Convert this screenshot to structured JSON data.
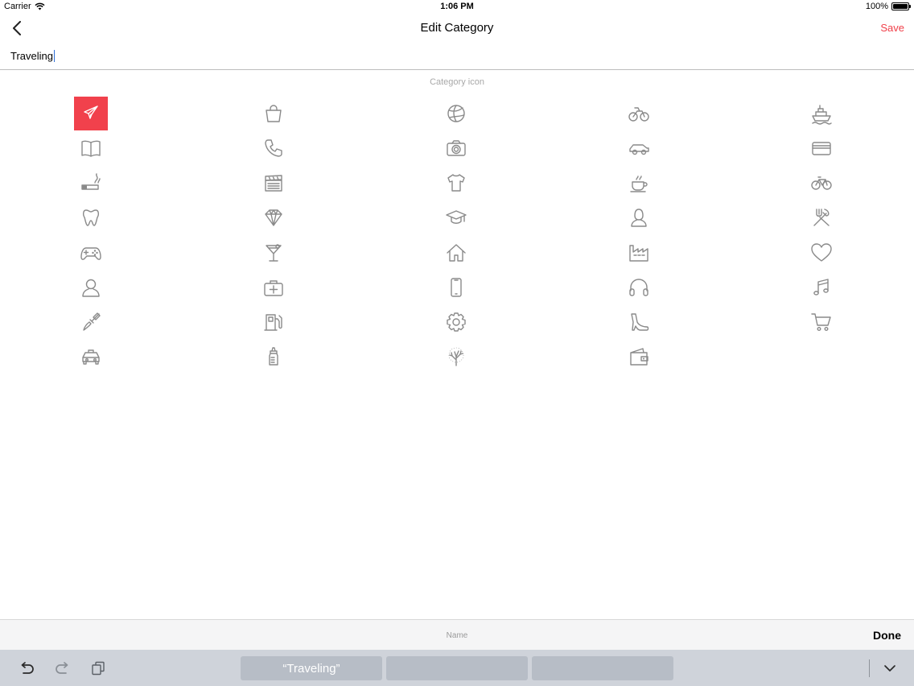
{
  "status_bar": {
    "carrier": "Carrier",
    "time": "1:06 PM",
    "battery": "100%",
    "battery_level": 1.0
  },
  "nav": {
    "title": "Edit Category",
    "save_label": "Save"
  },
  "name_field": {
    "value": "Traveling"
  },
  "section": {
    "label": "Category icon"
  },
  "icons": [
    "airplane-icon",
    "shopping-bag-icon",
    "volleyball-icon",
    "motorcycle-icon",
    "ship-icon",
    "book-icon",
    "phone-icon",
    "camera-icon",
    "car-icon",
    "credit-card-icon",
    "cigarette-icon",
    "clapperboard-icon",
    "tshirt-icon",
    "coffee-cup-icon",
    "bicycle-icon",
    "tooth-icon",
    "diamond-icon",
    "graduation-cap-icon",
    "person-female-icon",
    "fork-knife-icon",
    "gamepad-icon",
    "cocktail-icon",
    "home-icon",
    "factory-icon",
    "heart-icon",
    "person-icon",
    "first-aid-kit-icon",
    "smartphone-icon",
    "headphones-icon",
    "music-note-icon",
    "paint-brush-icon",
    "fuel-pump-icon",
    "gear-icon",
    "high-heel-icon",
    "shopping-cart-icon",
    "taxi-icon",
    "baby-bottle-icon",
    "tree-icon",
    "wallet-icon"
  ],
  "selected_icon": "airplane-icon",
  "accent_color": "#f1414c",
  "accessory": {
    "title": "Name",
    "done_label": "Done"
  },
  "shortcuts": {
    "undo": "undo-icon",
    "redo": "redo-icon",
    "paste": "paste-icon",
    "suggestions": [
      "“Traveling”",
      "",
      ""
    ],
    "dismiss": "chevron-down-icon"
  }
}
